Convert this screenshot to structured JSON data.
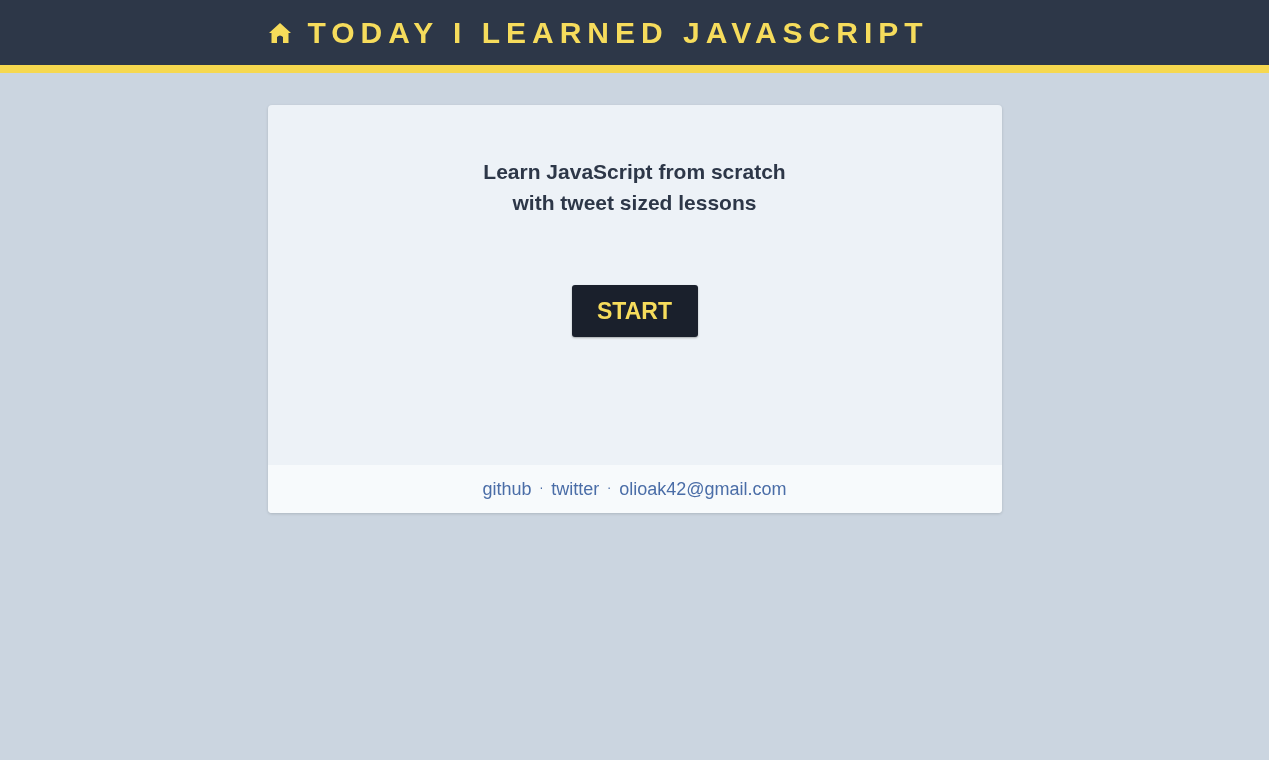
{
  "header": {
    "title": "TODAY I LEARNED JAVASCRIPT"
  },
  "intro": {
    "lines": [
      "Learn JavaScript from scratch",
      "with tweet sized lessons"
    ]
  },
  "start_button": {
    "label": "START"
  },
  "footer": {
    "items": [
      {
        "kind": "link",
        "text": "github"
      },
      {
        "kind": "separator",
        "text": "·"
      },
      {
        "kind": "link",
        "text": "twitter"
      },
      {
        "kind": "separator",
        "text": "·"
      },
      {
        "kind": "link",
        "text": "olioak42@gmail.com"
      }
    ]
  }
}
